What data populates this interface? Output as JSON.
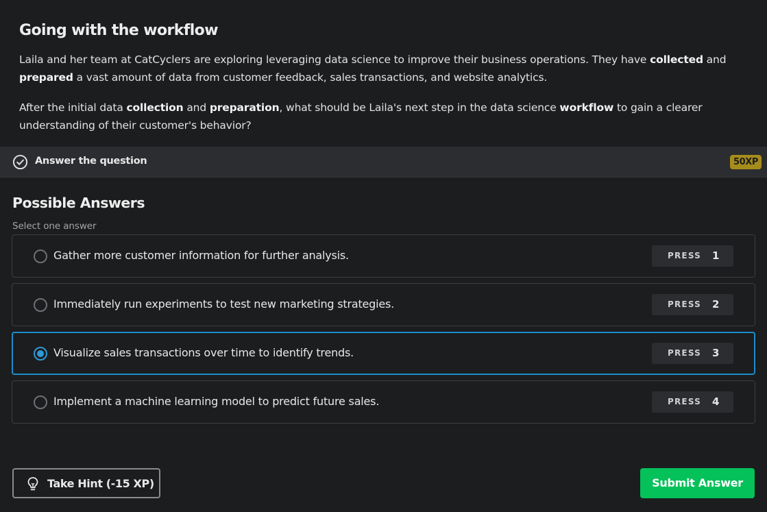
{
  "exercise": {
    "title": "Going with the workflow",
    "paragraph1": [
      {
        "text": "Laila and her team at CatCyclers are exploring leveraging data science to improve their business operations. They have ",
        "bold": false
      },
      {
        "text": "collected",
        "bold": true
      },
      {
        "text": " and ",
        "bold": false
      },
      {
        "text": "prepared",
        "bold": true
      },
      {
        "text": " a vast amount of data from customer feedback, sales transactions, and website analytics.",
        "bold": false
      }
    ],
    "paragraph2": [
      {
        "text": "After the initial data ",
        "bold": false
      },
      {
        "text": "collection",
        "bold": true
      },
      {
        "text": " and ",
        "bold": false
      },
      {
        "text": "preparation",
        "bold": true
      },
      {
        "text": ", what should be Laila's next step in the data science ",
        "bold": false
      },
      {
        "text": "workflow",
        "bold": true
      },
      {
        "text": " to gain a clearer understanding of their customer's behavior?",
        "bold": false
      }
    ]
  },
  "task": {
    "label": "Answer the question",
    "xp": "50XP",
    "icon": "check-circle-icon"
  },
  "answers": {
    "title": "Possible Answers",
    "hint": "Select one answer",
    "press_label": "PRESS",
    "options": [
      {
        "text": "Gather more customer information for further analysis.",
        "key": "1",
        "selected": false
      },
      {
        "text": "Immediately run experiments to test new marketing strategies.",
        "key": "2",
        "selected": false
      },
      {
        "text": "Visualize sales transactions over time to identify trends.",
        "key": "3",
        "selected": true
      },
      {
        "text": "Implement a machine learning model to predict future sales.",
        "key": "4",
        "selected": false
      }
    ]
  },
  "actions": {
    "hint_label": "Take Hint (-15 XP)",
    "hint_icon": "lightbulb-icon",
    "submit_label": "Submit Answer"
  },
  "colors": {
    "background": "#1c1d1f",
    "accent_selected": "#2e9ad6",
    "submit": "#05c15a",
    "xp_badge": "#a68d1b"
  }
}
